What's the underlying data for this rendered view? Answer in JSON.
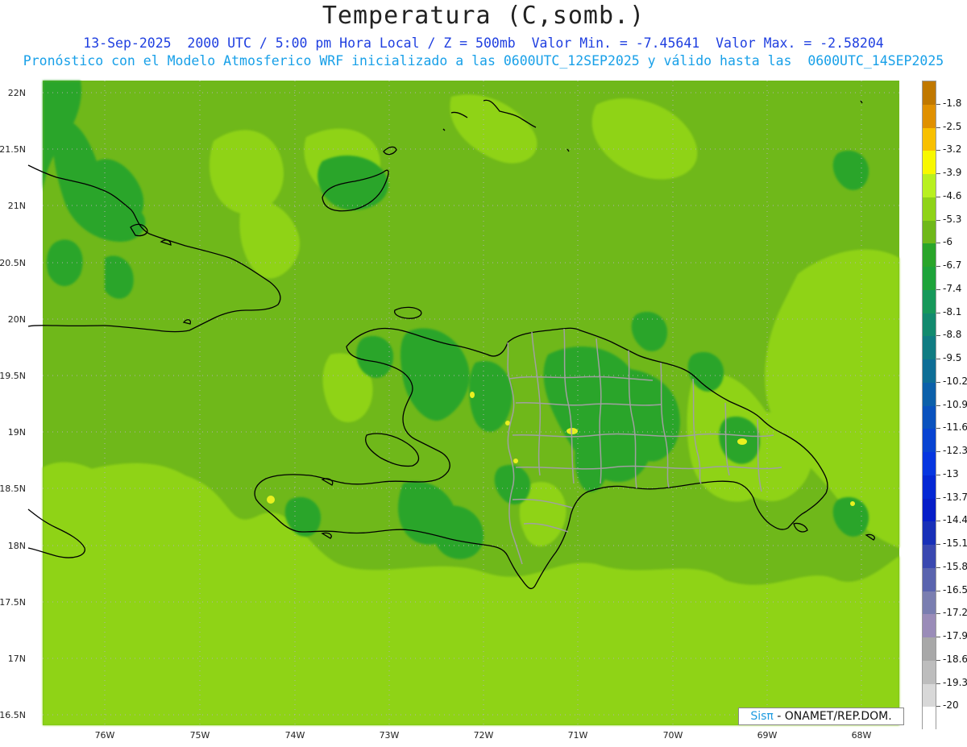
{
  "header": {
    "title": "Temperatura (C,somb.)",
    "line1": "13-Sep-2025  2000 UTC / 5:00 pm Hora Local / Z = 500mb  Valor Min. = -7.45641  Valor Max. = -2.58204",
    "line2": "Pronóstico con el Modelo Atmosferico WRF inicializado a las 0600UTC_12SEP2025 y válido hasta las  0600UTC_14SEP2025"
  },
  "map": {
    "lat_labels": [
      "22N",
      "21.5N",
      "21N",
      "20.5N",
      "20N",
      "19.5N",
      "19N",
      "18.5N",
      "18N",
      "17.5N",
      "17N",
      "16.5N"
    ],
    "lon_labels": [
      "76W",
      "75W",
      "74W",
      "73W",
      "72W",
      "71W",
      "70W",
      "69W",
      "68W"
    ],
    "background_color": "#6fb81a",
    "colors": {
      "base": "#6fb81a",
      "light": "#8fd318",
      "dark": "#2aa52a",
      "yellow": "#e8f020",
      "coast": "#000000",
      "border": "#a0a0a0"
    }
  },
  "credit": {
    "brand": "Sisπ",
    "text": " - ONAMET/REP.DOM."
  },
  "colorbar": {
    "labels": [
      "-1.8",
      "-2.5",
      "-3.2",
      "-3.9",
      "-4.6",
      "-5.3",
      "-6",
      "-6.7",
      "-7.4",
      "-8.1",
      "-8.8",
      "-9.5",
      "-10.2",
      "-10.9",
      "-11.6",
      "-12.3",
      "-13",
      "-13.7",
      "-14.4",
      "-15.1",
      "-15.8",
      "-16.5",
      "-17.2",
      "-17.9",
      "-18.6",
      "-19.3",
      "-20"
    ],
    "colors": [
      "#c07800",
      "#e09000",
      "#f8c000",
      "#f8f800",
      "#b8f020",
      "#8fd318",
      "#6fb81a",
      "#2aa52a",
      "#1ea33a",
      "#16985a",
      "#128a6e",
      "#107c82",
      "#0e6e96",
      "#0c60aa",
      "#0a52be",
      "#0844d2",
      "#0636e0",
      "#0428d4",
      "#061ec8",
      "#1830b8",
      "#3a48b0",
      "#5a64ae",
      "#7a7eb0",
      "#9a8cb8",
      "#a8a8a8",
      "#bdbdbd",
      "#d8d8d8",
      "#ffffff"
    ]
  }
}
